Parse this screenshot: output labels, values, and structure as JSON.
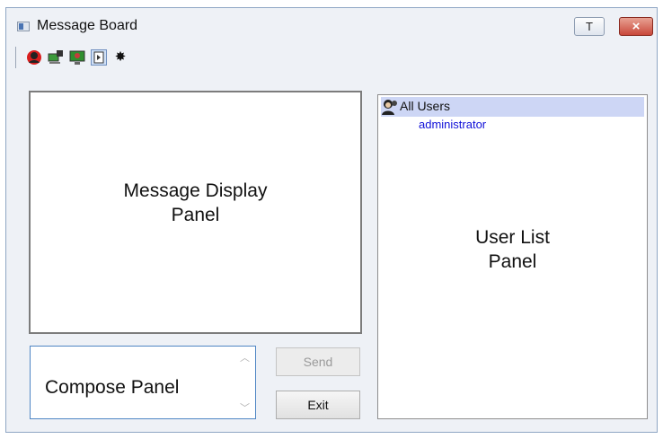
{
  "window": {
    "title": "Message Board"
  },
  "title_buttons": {
    "pin": "T",
    "close": "×"
  },
  "toolbar": [
    {
      "icon": "red-user-icon"
    },
    {
      "icon": "monitor-user-icon"
    },
    {
      "icon": "green-monitor-icon"
    },
    {
      "icon": "panel-toggle-icon",
      "selected": true
    },
    {
      "icon": "gear-icon"
    }
  ],
  "message_panel": {
    "label": "Message Display\nPanel"
  },
  "compose_panel": {
    "label": "Compose Panel"
  },
  "buttons": {
    "send": "Send",
    "exit": "Exit"
  },
  "user_list": {
    "group": "All Users",
    "users": [
      "administrator"
    ],
    "label": "User List\nPanel"
  }
}
